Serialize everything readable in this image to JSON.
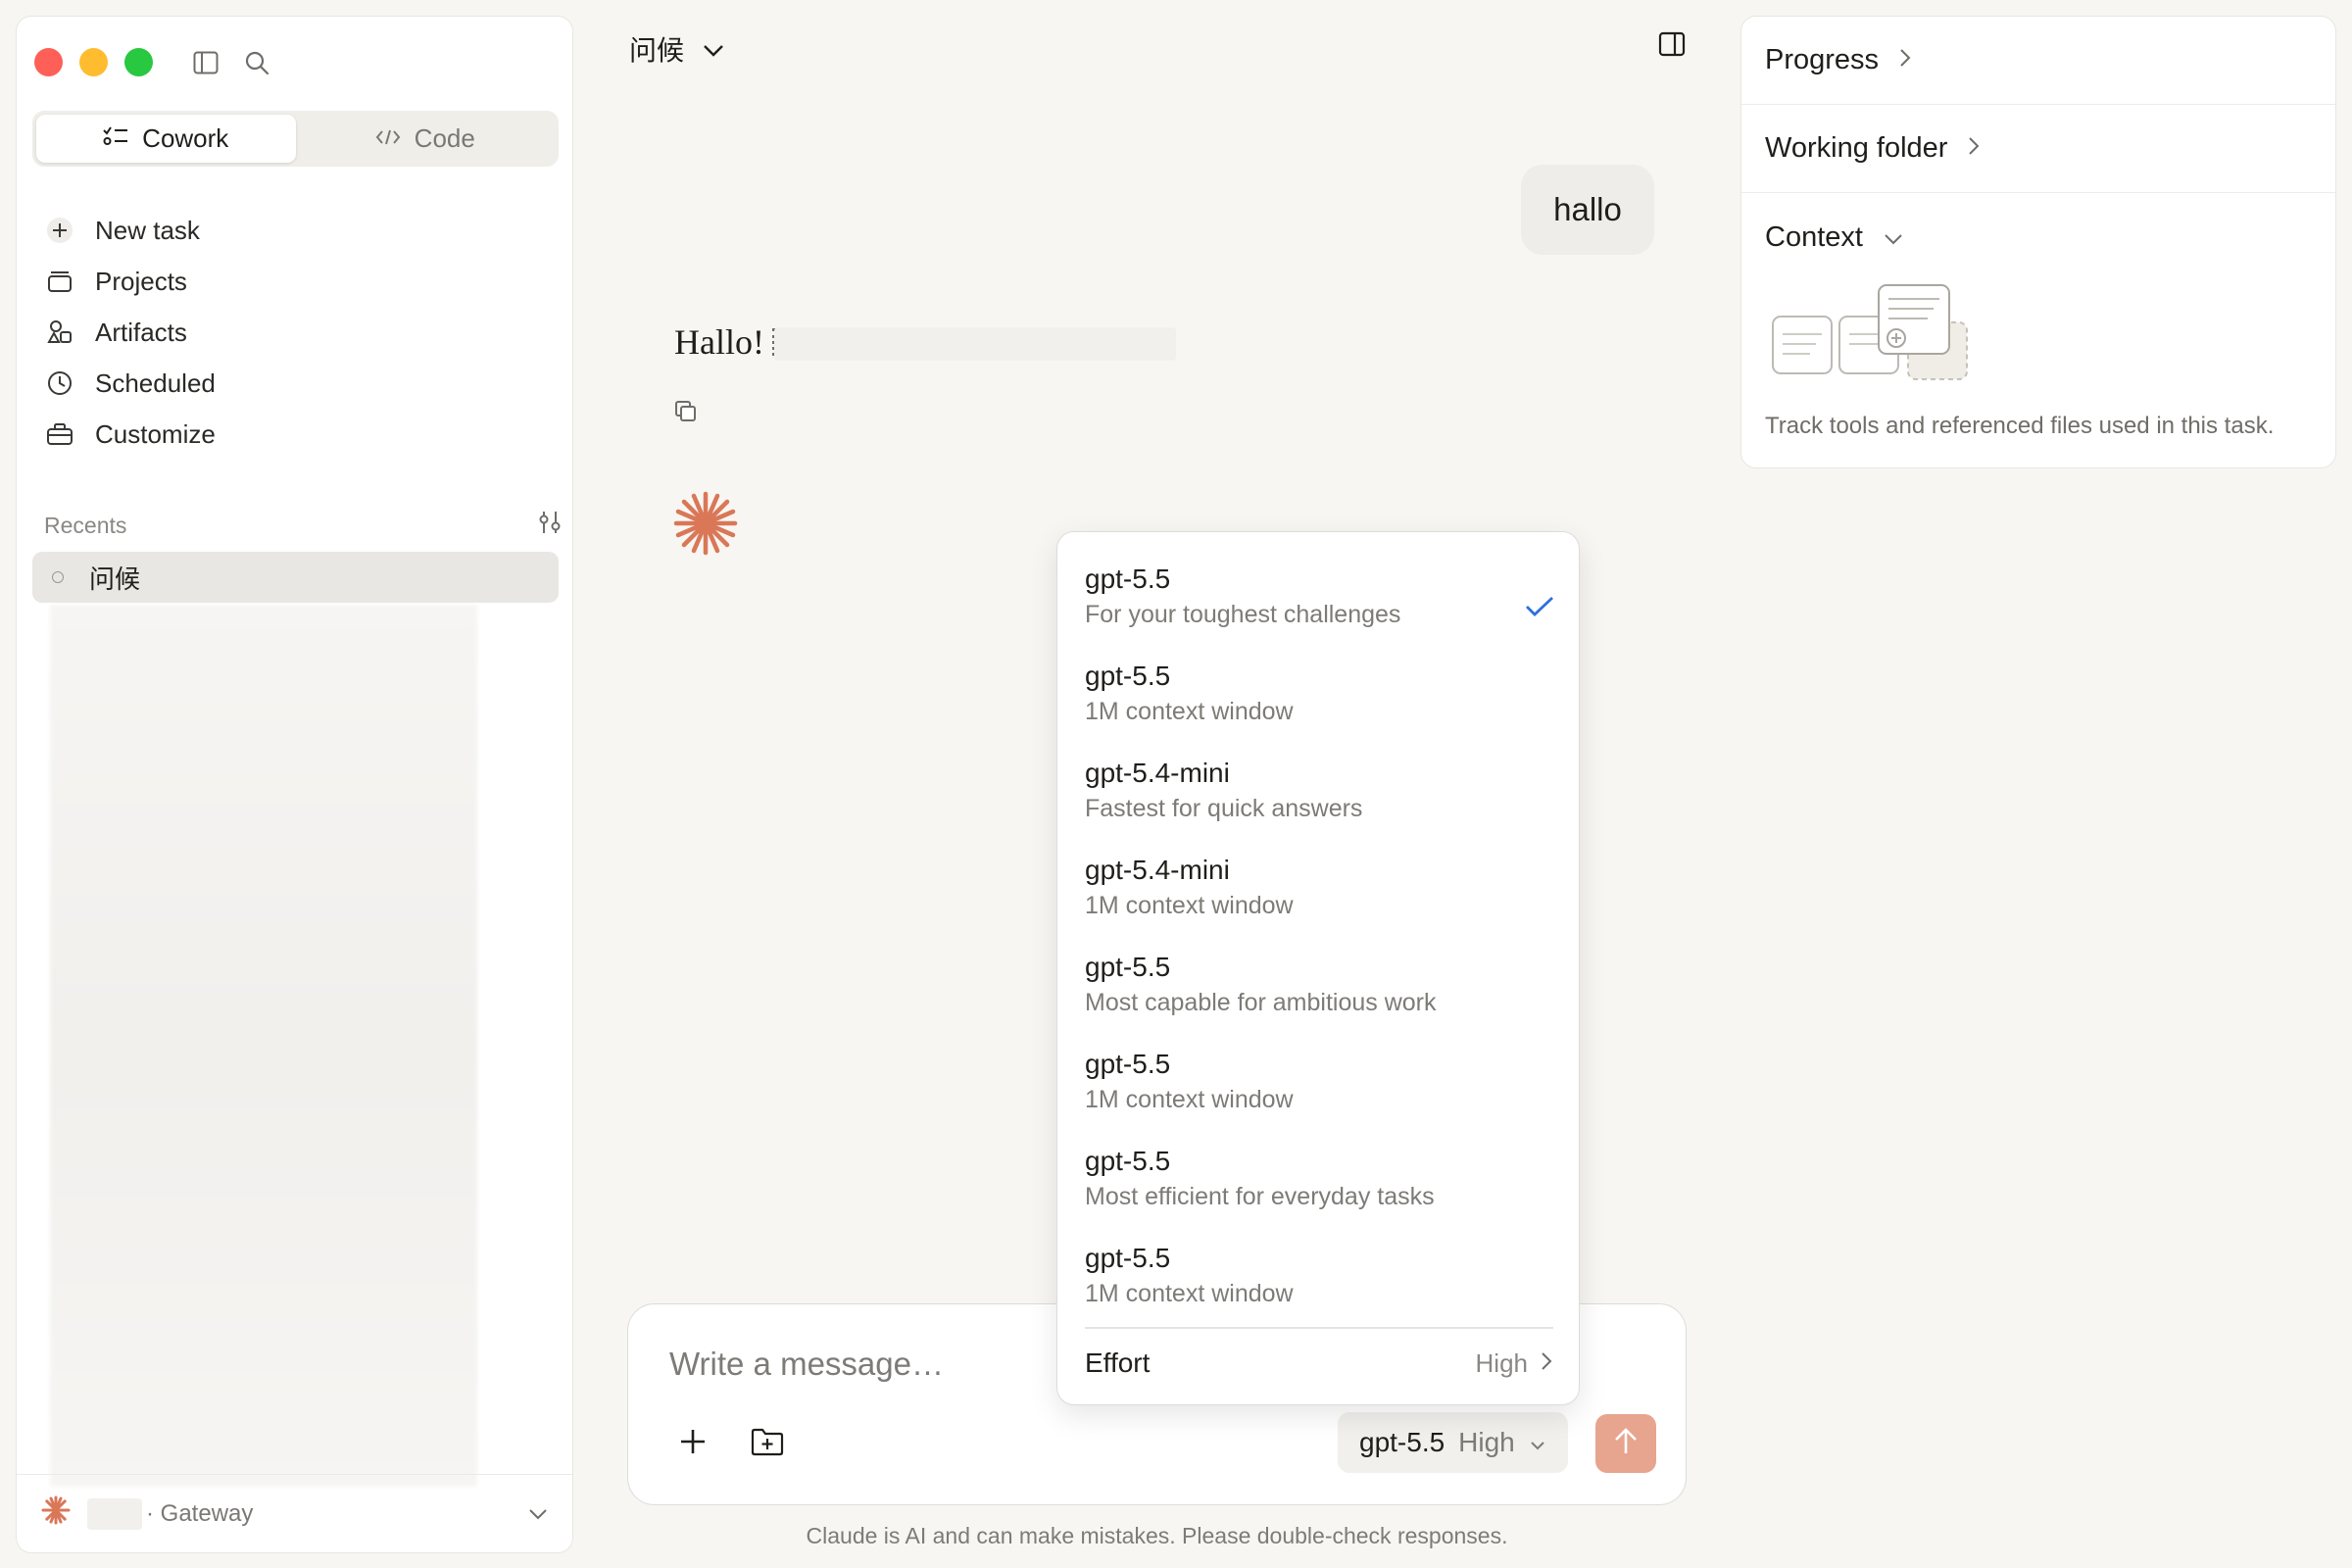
{
  "sidebar": {
    "modes": [
      {
        "label": "Cowork",
        "active": true
      },
      {
        "label": "Code",
        "active": false
      }
    ],
    "nav": [
      {
        "label": "New task",
        "icon": "plus-icon"
      },
      {
        "label": "Projects",
        "icon": "folder-stack-icon"
      },
      {
        "label": "Artifacts",
        "icon": "shapes-icon"
      },
      {
        "label": "Scheduled",
        "icon": "clock-icon"
      },
      {
        "label": "Customize",
        "icon": "briefcase-icon"
      }
    ],
    "recents_label": "Recents",
    "recents": [
      {
        "title": "问候"
      }
    ],
    "footer_label": "· Gateway"
  },
  "main": {
    "title": "问候",
    "user_message": "hallo",
    "assistant_message": "Hallo!"
  },
  "composer": {
    "placeholder": "Write a message…",
    "model": "gpt-5.5",
    "effort": "High",
    "disclaimer": "Claude is AI and can make mistakes. Please double-check responses."
  },
  "model_menu": {
    "items": [
      {
        "name": "gpt-5.5",
        "desc": "For your toughest challenges",
        "selected": true
      },
      {
        "name": "gpt-5.5",
        "desc": "1M context window",
        "selected": false
      },
      {
        "name": "gpt-5.4-mini",
        "desc": "Fastest for quick answers",
        "selected": false
      },
      {
        "name": "gpt-5.4-mini",
        "desc": "1M context window",
        "selected": false
      },
      {
        "name": "gpt-5.5",
        "desc": "Most capable for ambitious work",
        "selected": false
      },
      {
        "name": "gpt-5.5",
        "desc": "1M context window",
        "selected": false
      },
      {
        "name": "gpt-5.5",
        "desc": "Most efficient for everyday tasks",
        "selected": false
      },
      {
        "name": "gpt-5.5",
        "desc": "1M context window",
        "selected": false
      }
    ],
    "effort_label": "Effort",
    "effort_value": "High"
  },
  "right_panel": {
    "progress": "Progress",
    "working_folder": "Working folder",
    "context": "Context",
    "context_caption": "Track tools and referenced files used in this task."
  },
  "colors": {
    "accent": "#d97757",
    "send_button": "#e7a48e",
    "check": "#2f6fdc"
  }
}
